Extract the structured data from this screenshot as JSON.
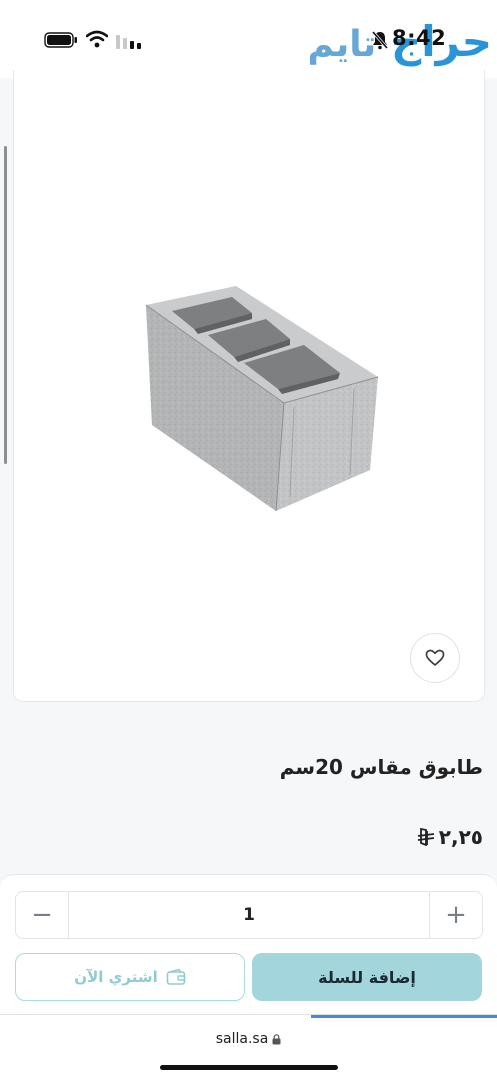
{
  "status_bar": {
    "time": "8:42",
    "battery_icon": "battery-icon",
    "wifi_icon": "wifi-icon",
    "signal_icon": "signal-icon",
    "mute_icon": "bell-off-icon"
  },
  "watermark": {
    "word1": "حراج",
    "word2": "تايم"
  },
  "product": {
    "title": "طابوق مقاس 20سم",
    "price": "٢,٢٥",
    "currency_icon": "sar-currency-icon",
    "favorite_icon": "heart-icon"
  },
  "purchase": {
    "quantity": "1",
    "minus_label": "−",
    "plus_label": "+",
    "add_to_cart_label": "إضافة للسلة",
    "buy_now_label": "اشتري الآن",
    "buy_now_icon": "wallet-icon"
  },
  "browser": {
    "url": "salla.sa",
    "lock_icon": "lock-icon"
  },
  "colors": {
    "accent": "#a3d6dc",
    "accent_border": "#a9dbe0",
    "watermark_blue": "#1e90d8",
    "progress_blue": "#3f8be0"
  }
}
